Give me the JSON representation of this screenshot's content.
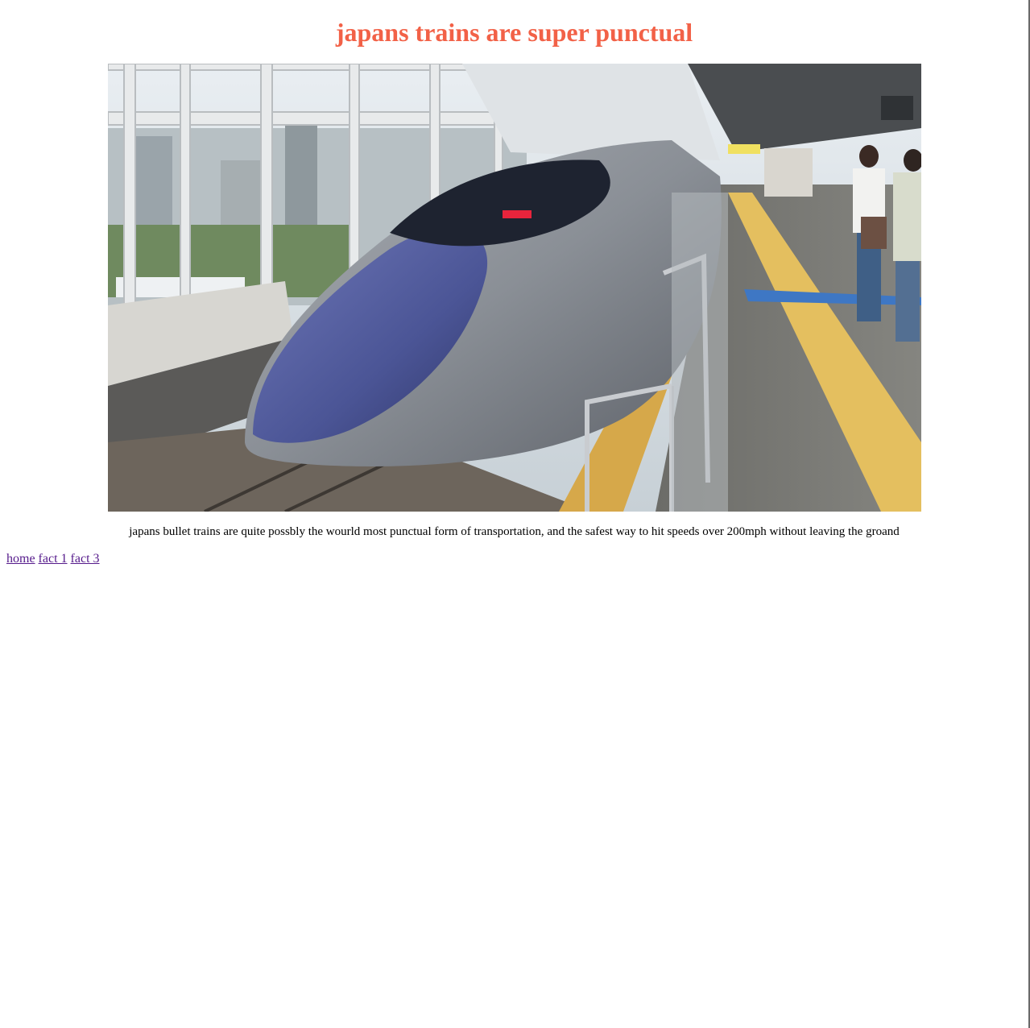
{
  "page": {
    "title": "japans trains are super punctual",
    "title_color": "#f26147"
  },
  "photo": {
    "subject": "bullet train at station platform"
  },
  "caption": "japans bullet trains are quite possbly the wourld most punctual form of transportation, and the safest way to hit speeds over 200mph without leaving the groand",
  "nav": {
    "links": [
      "home",
      "fact 1",
      "fact 3"
    ],
    "link_color": "#551a8b"
  }
}
